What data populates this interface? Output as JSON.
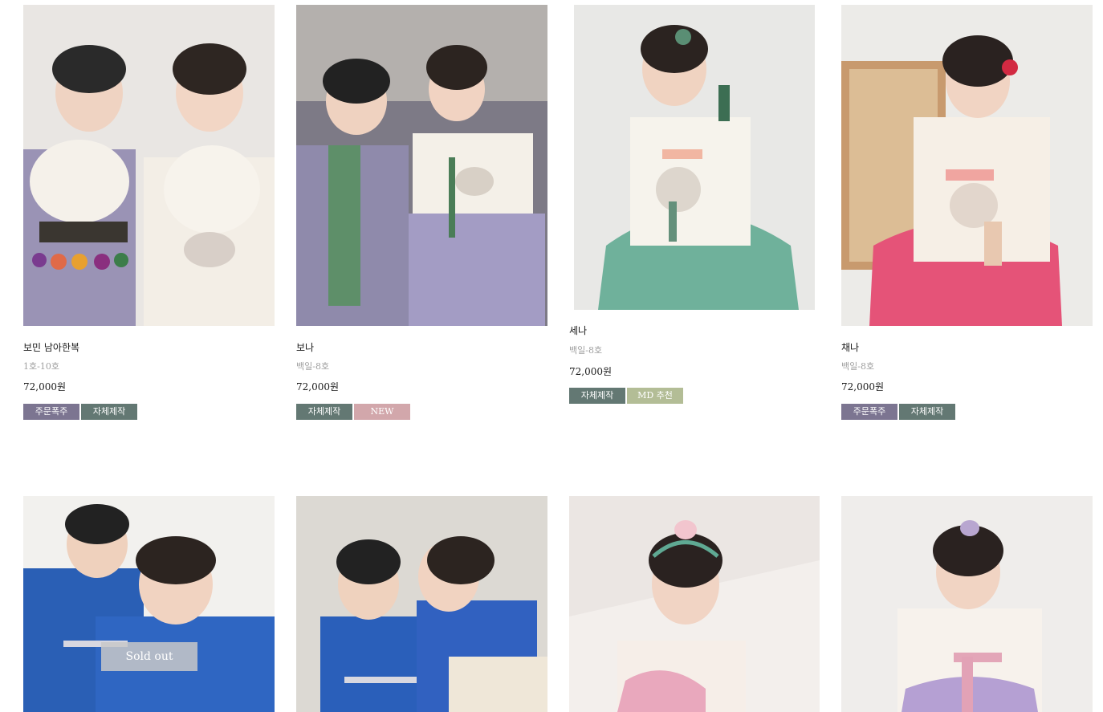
{
  "badge_colors": {
    "popular": "#7c7591",
    "handmade": "#637873",
    "new": "#d2a7ab",
    "md": "#b3bd96"
  },
  "products": [
    {
      "name": "보민 남아한복",
      "size": "1호-10호",
      "price": "72,000원",
      "badges": [
        {
          "label": "주문폭주",
          "type": "popular"
        },
        {
          "label": "자체제작",
          "type": "handmade"
        }
      ]
    },
    {
      "name": "보나",
      "size": "백일-8호",
      "price": "72,000원",
      "badges": [
        {
          "label": "자체제작",
          "type": "handmade"
        },
        {
          "label": "NEW",
          "type": "new"
        }
      ]
    },
    {
      "name": "세나",
      "size": "백일-8호",
      "price": "72,000원",
      "badges": [
        {
          "label": "자체제작",
          "type": "handmade"
        },
        {
          "label": "MD 추천",
          "type": "md"
        }
      ]
    },
    {
      "name": "채나",
      "size": "백일-8호",
      "price": "72,000원",
      "badges": [
        {
          "label": "주문폭주",
          "type": "popular"
        },
        {
          "label": "자체제작",
          "type": "handmade"
        }
      ]
    },
    {
      "soldout_label": "Sold out"
    },
    {},
    {},
    {}
  ]
}
